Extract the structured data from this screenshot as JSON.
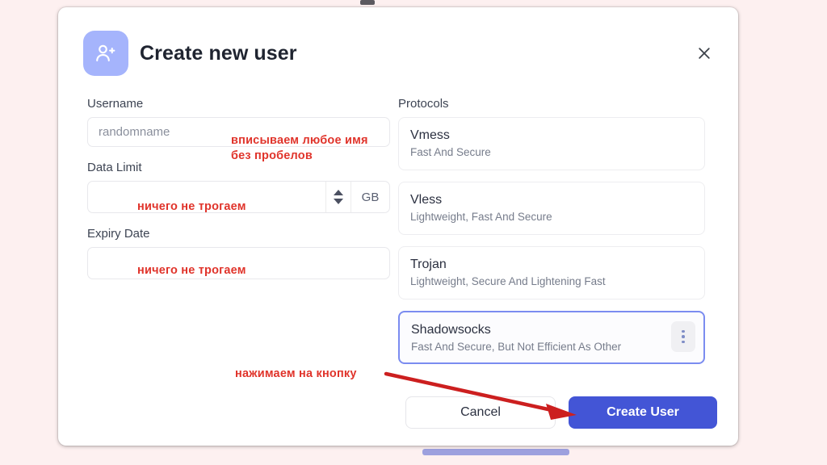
{
  "window": {
    "background_color": "#fdf0f0",
    "card_background": "#ffffff"
  },
  "header": {
    "title": "Create new user",
    "icon": "user-plus-icon",
    "icon_bg": "#a5b4fc",
    "close_icon": "close-icon"
  },
  "form": {
    "username": {
      "label": "Username",
      "placeholder": "randomname",
      "value": ""
    },
    "data_limit": {
      "label": "Data Limit",
      "value": "",
      "unit": "GB",
      "spinner_up": "spin-up-icon",
      "spinner_down": "spin-down-icon"
    },
    "expiry_date": {
      "label": "Expiry Date",
      "value": ""
    }
  },
  "protocols": {
    "label": "Protocols",
    "selected": "Shadowsocks",
    "items": [
      {
        "name": "Vmess",
        "description": "Fast And Secure",
        "selected": false,
        "has_menu": false
      },
      {
        "name": "Vless",
        "description": "Lightweight, Fast And Secure",
        "selected": false,
        "has_menu": false
      },
      {
        "name": "Trojan",
        "description": "Lightweight, Secure And Lightening Fast",
        "selected": false,
        "has_menu": false
      },
      {
        "name": "Shadowsocks",
        "description": "Fast And Secure, But Not Efficient As Other",
        "selected": true,
        "has_menu": true,
        "menu_icon": "more-vertical-icon"
      }
    ]
  },
  "footer": {
    "cancel_label": "Cancel",
    "create_label": "Create User",
    "create_color": "#4355d6"
  },
  "annotations": {
    "color": "#e0342b",
    "username_note_line1": "вписываем любое имя",
    "username_note_line2": "без пробелов",
    "data_limit_note": "ничего не трогаем",
    "expiry_note": "ничего не трогаем",
    "button_note": "нажимаем на кнопку",
    "arrow": "red-arrow-annotation"
  }
}
